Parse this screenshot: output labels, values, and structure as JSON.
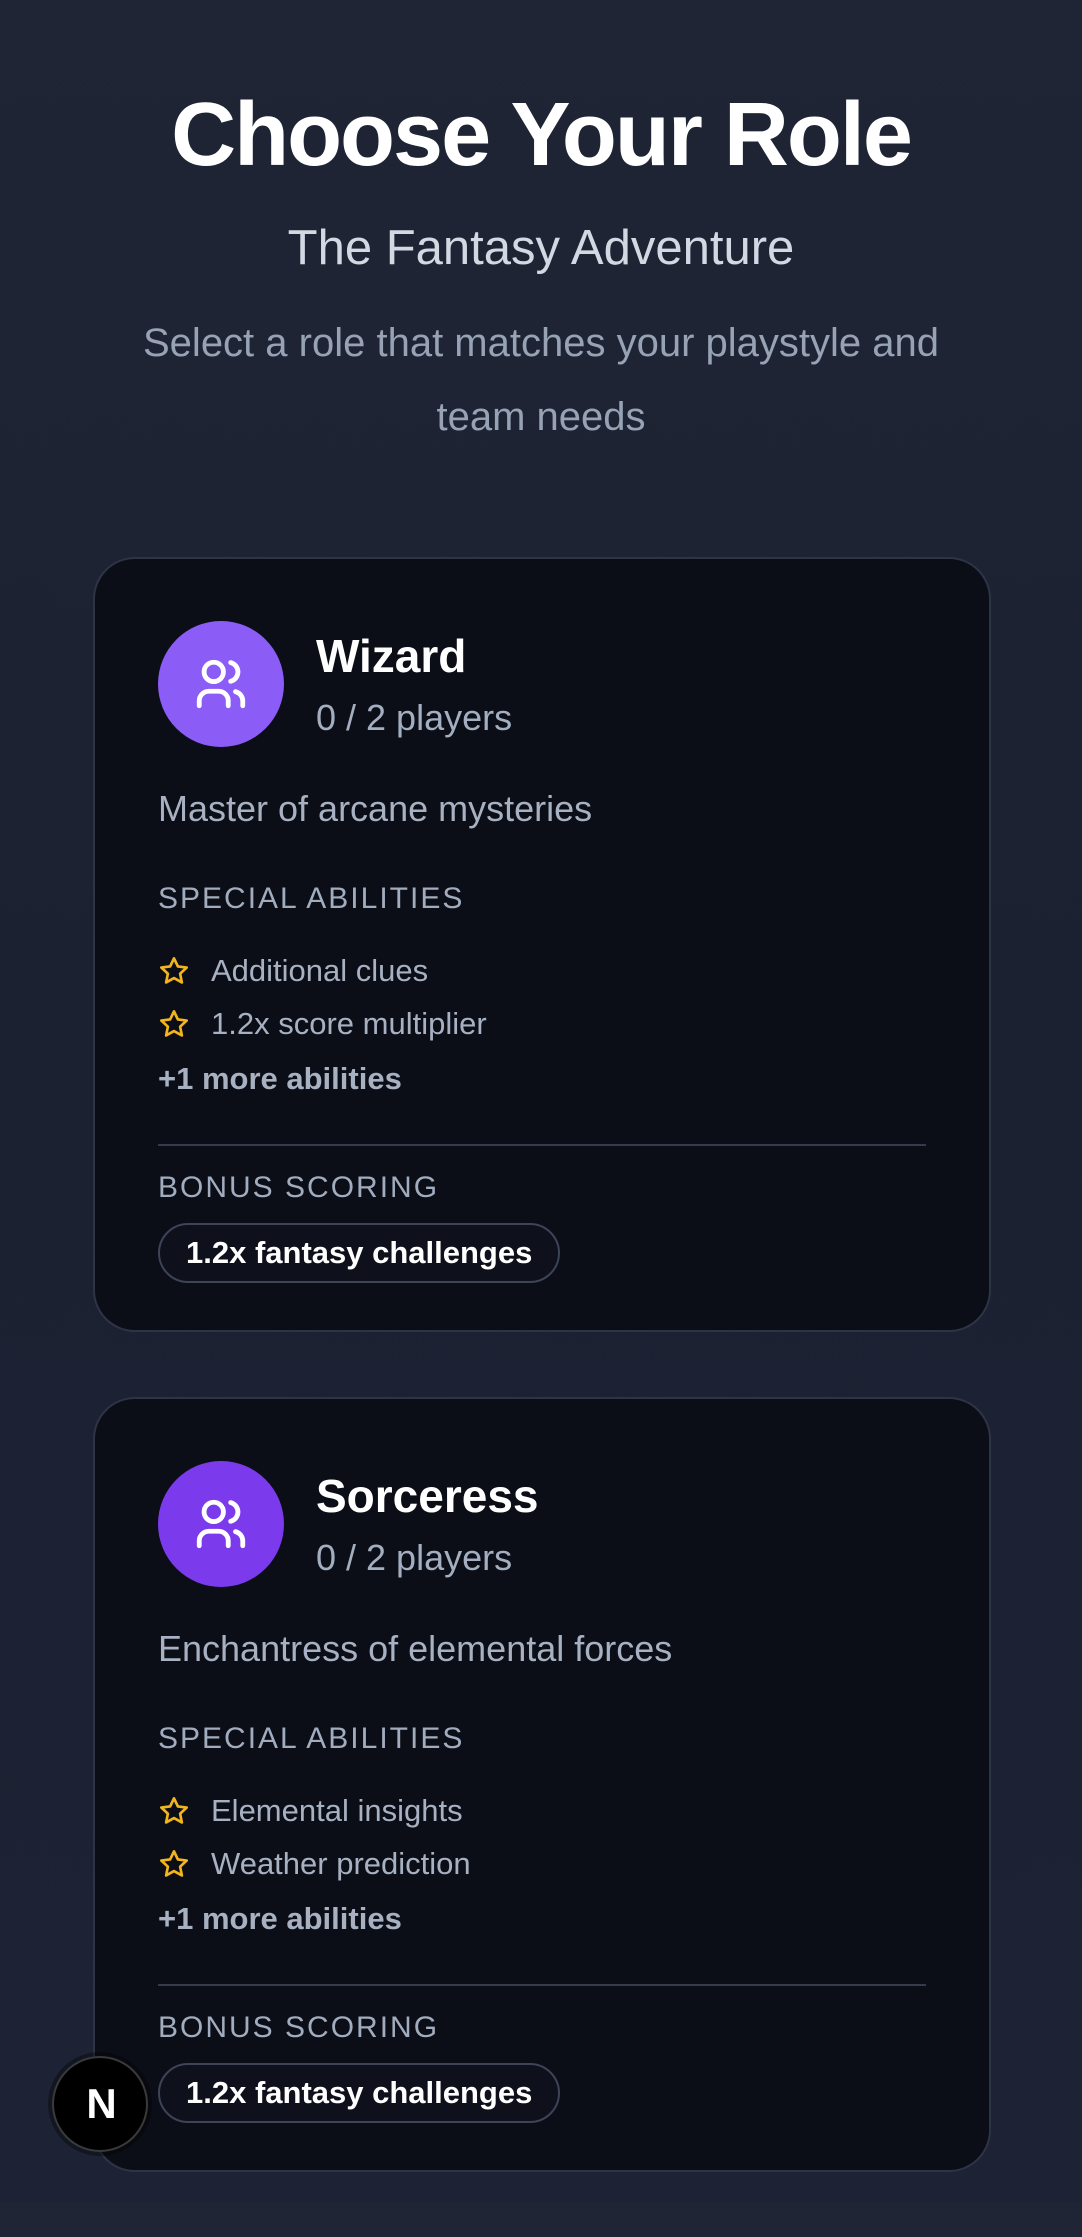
{
  "header": {
    "title": "Choose Your Role",
    "subtitle": "The Fantasy Adventure",
    "description": "Select a role that matches your playstyle and team needs"
  },
  "colors": {
    "accent_star": "#f2b51d",
    "avatar_wizard": "#8b5cf6",
    "avatar_sorceress": "#7c3aed"
  },
  "roles": [
    {
      "name": "Wizard",
      "players": "0 / 2 players",
      "description": "Master of arcane mysteries",
      "abilities_label": "SPECIAL ABILITIES",
      "abilities": [
        "Additional clues",
        "1.2x score multiplier"
      ],
      "more_abilities": "+1 more abilities",
      "bonus_label": "BONUS SCORING",
      "bonus": "1.2x fantasy challenges",
      "icon": "users-icon"
    },
    {
      "name": "Sorceress",
      "players": "0 / 2 players",
      "description": "Enchantress of elemental forces",
      "abilities_label": "SPECIAL ABILITIES",
      "abilities": [
        "Elemental insights",
        "Weather prediction"
      ],
      "more_abilities": "+1 more abilities",
      "bonus_label": "BONUS SCORING",
      "bonus": "1.2x fantasy challenges",
      "icon": "users-icon"
    }
  ],
  "fab": {
    "label": "N",
    "icon": "nextjs-logo-icon"
  }
}
